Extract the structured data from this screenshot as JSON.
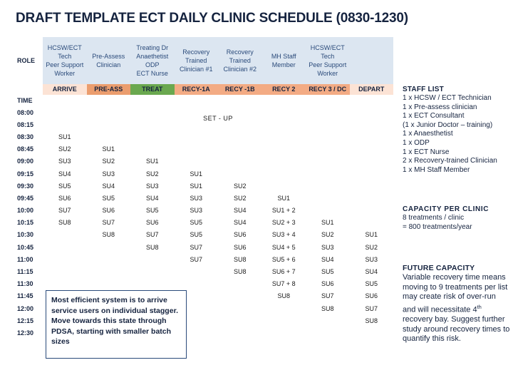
{
  "title": "DRAFT TEMPLATE ECT DAILY CLINIC SCHEDULE (0830-1230)",
  "table": {
    "role_label": "ROLE",
    "time_label": "TIME",
    "setup_label": "SET - UP",
    "roles": [
      [
        "HCSW/ECT",
        "Tech",
        "Peer Support",
        "Worker"
      ],
      [
        "Pre-Assess",
        "Clinician"
      ],
      [
        "Treating Dr",
        "Anaethetist",
        "ODP",
        "ECT Nurse"
      ],
      [
        "Recovery",
        "Trained",
        "Clinician #1"
      ],
      [
        "Recovery",
        "Trained",
        "Clinician #2"
      ],
      [
        "MH Staff",
        "Member"
      ],
      [
        "HCSW/ECT",
        "Tech",
        "Peer Support",
        "Worker"
      ],
      [
        ""
      ]
    ],
    "stages": [
      "ARRIVE",
      "PRE-ASS",
      "TREAT",
      "RECY-1A",
      "RECY -1B",
      "RECY 2",
      "RECY 3 / DC",
      "DEPART"
    ],
    "times": [
      "08:00",
      "08:15",
      "08:30",
      "08:45",
      "09:00",
      "09:15",
      "09:30",
      "09:45",
      "10:00",
      "10:15",
      "10:30",
      "10:45",
      "11:00",
      "11:15",
      "11:30",
      "11:45",
      "12:00",
      "12:15",
      "12:30"
    ],
    "grid": [
      [
        "",
        "",
        "",
        "",
        "",
        "",
        "",
        ""
      ],
      [
        "",
        "",
        "",
        "",
        "",
        "",
        "",
        ""
      ],
      [
        "SU1",
        "",
        "",
        "",
        "",
        "",
        "",
        ""
      ],
      [
        "SU2",
        "SU1",
        "",
        "",
        "",
        "",
        "",
        ""
      ],
      [
        "SU3",
        "SU2",
        "SU1",
        "",
        "",
        "",
        "",
        ""
      ],
      [
        "SU4",
        "SU3",
        "SU2",
        "SU1",
        "",
        "",
        "",
        ""
      ],
      [
        "SU5",
        "SU4",
        "SU3",
        "SU1",
        "SU2",
        "",
        "",
        ""
      ],
      [
        "SU6",
        "SU5",
        "SU4",
        "SU3",
        "SU2",
        "SU1",
        "",
        ""
      ],
      [
        "SU7",
        "SU6",
        "SU5",
        "SU3",
        "SU4",
        "SU1 + 2",
        "",
        ""
      ],
      [
        "SU8",
        "SU7",
        "SU6",
        "SU5",
        "SU4",
        "SU2 + 3",
        "SU1",
        ""
      ],
      [
        "",
        "SU8",
        "SU7",
        "SU5",
        "SU6",
        "SU3 + 4",
        "SU2",
        "SU1"
      ],
      [
        "",
        "",
        "SU8",
        "SU7",
        "SU6",
        "SU4 + 5",
        "SU3",
        "SU2"
      ],
      [
        "",
        "",
        "",
        "SU7",
        "SU8",
        "SU5 + 6",
        "SU4",
        "SU3"
      ],
      [
        "",
        "",
        "",
        "",
        "SU8",
        "SU6 + 7",
        "SU5",
        "SU4"
      ],
      [
        "",
        "",
        "",
        "",
        "",
        "SU7 + 8",
        "SU6",
        "SU5"
      ],
      [
        "",
        "",
        "",
        "",
        "",
        "SU8",
        "SU7",
        "SU6"
      ],
      [
        "",
        "",
        "",
        "",
        "",
        "",
        "SU8",
        "SU7"
      ],
      [
        "",
        "",
        "",
        "",
        "",
        "",
        "",
        "SU8"
      ],
      [
        "",
        "",
        "",
        "",
        "",
        "",
        "",
        ""
      ]
    ]
  },
  "callout": {
    "text": "Most efficient system is to arrive service users on individual stagger. Move towards this state through PDSA, starting with smaller batch sizes"
  },
  "staff_list": {
    "heading": "STAFF LIST",
    "items": [
      "1 x HCSW / ECT Technician",
      "1 x Pre-assess clinician",
      "1 x ECT Consultant",
      "(1 x Junior Doctor – training)",
      "1 x Anaesthetist",
      "1 x ODP",
      "1 x ECT Nurse",
      "2 x Recovery-trained Clinician",
      "1 x MH Staff Member"
    ]
  },
  "capacity": {
    "heading": "CAPACITY PER CLINIC",
    "items": [
      "8 treatments / clinic",
      "= 800 treatments/year"
    ]
  },
  "future_capacity": {
    "heading": "FUTURE CAPACITY",
    "text_before": "Variable recovery time means moving to 9 treatments per list may create risk of over-run and will necessitate 4",
    "ordinal": "th",
    "text_after": " recovery bay.  Suggest further study around recovery times to quantify this risk."
  },
  "colors": {
    "title": "#15233f",
    "role_header_bg": "#dce6f1",
    "arrive": "#fce3d5",
    "preass": "#eb9d6e",
    "treat": "#6aa84f",
    "recovery": "#f3ab84",
    "depart": "#fce3d5",
    "setup": "#bfbfbf",
    "callout_border": "#2a4a7a"
  }
}
